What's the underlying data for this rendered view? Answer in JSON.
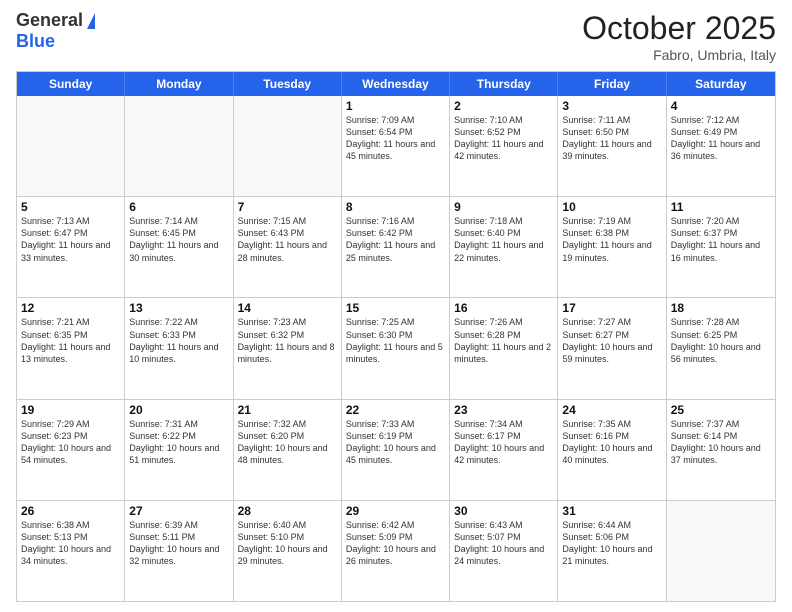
{
  "logo": {
    "general": "General",
    "blue": "Blue"
  },
  "title": "October 2025",
  "location": "Fabro, Umbria, Italy",
  "days_of_week": [
    "Sunday",
    "Monday",
    "Tuesday",
    "Wednesday",
    "Thursday",
    "Friday",
    "Saturday"
  ],
  "weeks": [
    [
      {
        "day": "",
        "info": ""
      },
      {
        "day": "",
        "info": ""
      },
      {
        "day": "",
        "info": ""
      },
      {
        "day": "1",
        "info": "Sunrise: 7:09 AM\nSunset: 6:54 PM\nDaylight: 11 hours and 45 minutes."
      },
      {
        "day": "2",
        "info": "Sunrise: 7:10 AM\nSunset: 6:52 PM\nDaylight: 11 hours and 42 minutes."
      },
      {
        "day": "3",
        "info": "Sunrise: 7:11 AM\nSunset: 6:50 PM\nDaylight: 11 hours and 39 minutes."
      },
      {
        "day": "4",
        "info": "Sunrise: 7:12 AM\nSunset: 6:49 PM\nDaylight: 11 hours and 36 minutes."
      }
    ],
    [
      {
        "day": "5",
        "info": "Sunrise: 7:13 AM\nSunset: 6:47 PM\nDaylight: 11 hours and 33 minutes."
      },
      {
        "day": "6",
        "info": "Sunrise: 7:14 AM\nSunset: 6:45 PM\nDaylight: 11 hours and 30 minutes."
      },
      {
        "day": "7",
        "info": "Sunrise: 7:15 AM\nSunset: 6:43 PM\nDaylight: 11 hours and 28 minutes."
      },
      {
        "day": "8",
        "info": "Sunrise: 7:16 AM\nSunset: 6:42 PM\nDaylight: 11 hours and 25 minutes."
      },
      {
        "day": "9",
        "info": "Sunrise: 7:18 AM\nSunset: 6:40 PM\nDaylight: 11 hours and 22 minutes."
      },
      {
        "day": "10",
        "info": "Sunrise: 7:19 AM\nSunset: 6:38 PM\nDaylight: 11 hours and 19 minutes."
      },
      {
        "day": "11",
        "info": "Sunrise: 7:20 AM\nSunset: 6:37 PM\nDaylight: 11 hours and 16 minutes."
      }
    ],
    [
      {
        "day": "12",
        "info": "Sunrise: 7:21 AM\nSunset: 6:35 PM\nDaylight: 11 hours and 13 minutes."
      },
      {
        "day": "13",
        "info": "Sunrise: 7:22 AM\nSunset: 6:33 PM\nDaylight: 11 hours and 10 minutes."
      },
      {
        "day": "14",
        "info": "Sunrise: 7:23 AM\nSunset: 6:32 PM\nDaylight: 11 hours and 8 minutes."
      },
      {
        "day": "15",
        "info": "Sunrise: 7:25 AM\nSunset: 6:30 PM\nDaylight: 11 hours and 5 minutes."
      },
      {
        "day": "16",
        "info": "Sunrise: 7:26 AM\nSunset: 6:28 PM\nDaylight: 11 hours and 2 minutes."
      },
      {
        "day": "17",
        "info": "Sunrise: 7:27 AM\nSunset: 6:27 PM\nDaylight: 10 hours and 59 minutes."
      },
      {
        "day": "18",
        "info": "Sunrise: 7:28 AM\nSunset: 6:25 PM\nDaylight: 10 hours and 56 minutes."
      }
    ],
    [
      {
        "day": "19",
        "info": "Sunrise: 7:29 AM\nSunset: 6:23 PM\nDaylight: 10 hours and 54 minutes."
      },
      {
        "day": "20",
        "info": "Sunrise: 7:31 AM\nSunset: 6:22 PM\nDaylight: 10 hours and 51 minutes."
      },
      {
        "day": "21",
        "info": "Sunrise: 7:32 AM\nSunset: 6:20 PM\nDaylight: 10 hours and 48 minutes."
      },
      {
        "day": "22",
        "info": "Sunrise: 7:33 AM\nSunset: 6:19 PM\nDaylight: 10 hours and 45 minutes."
      },
      {
        "day": "23",
        "info": "Sunrise: 7:34 AM\nSunset: 6:17 PM\nDaylight: 10 hours and 42 minutes."
      },
      {
        "day": "24",
        "info": "Sunrise: 7:35 AM\nSunset: 6:16 PM\nDaylight: 10 hours and 40 minutes."
      },
      {
        "day": "25",
        "info": "Sunrise: 7:37 AM\nSunset: 6:14 PM\nDaylight: 10 hours and 37 minutes."
      }
    ],
    [
      {
        "day": "26",
        "info": "Sunrise: 6:38 AM\nSunset: 5:13 PM\nDaylight: 10 hours and 34 minutes."
      },
      {
        "day": "27",
        "info": "Sunrise: 6:39 AM\nSunset: 5:11 PM\nDaylight: 10 hours and 32 minutes."
      },
      {
        "day": "28",
        "info": "Sunrise: 6:40 AM\nSunset: 5:10 PM\nDaylight: 10 hours and 29 minutes."
      },
      {
        "day": "29",
        "info": "Sunrise: 6:42 AM\nSunset: 5:09 PM\nDaylight: 10 hours and 26 minutes."
      },
      {
        "day": "30",
        "info": "Sunrise: 6:43 AM\nSunset: 5:07 PM\nDaylight: 10 hours and 24 minutes."
      },
      {
        "day": "31",
        "info": "Sunrise: 6:44 AM\nSunset: 5:06 PM\nDaylight: 10 hours and 21 minutes."
      },
      {
        "day": "",
        "info": ""
      }
    ]
  ]
}
